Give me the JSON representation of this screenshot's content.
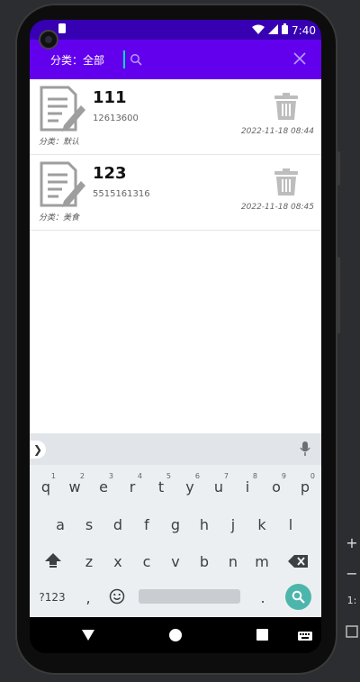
{
  "status_bar": {
    "time": "7:40"
  },
  "app_bar": {
    "category_label": "分类：全部",
    "search_value": "",
    "search_icon": "search-icon",
    "clear_icon": "close-icon"
  },
  "notes": [
    {
      "title": "111",
      "content": "12613600",
      "category": "分类：默认",
      "time": "2022-11-18 08:44"
    },
    {
      "title": "123",
      "content": "5515161316",
      "category": "分类：美食",
      "time": "2022-11-18 08:45"
    }
  ],
  "keyboard": {
    "row1": [
      {
        "key": "q",
        "sup": "1"
      },
      {
        "key": "w",
        "sup": "2"
      },
      {
        "key": "e",
        "sup": "3"
      },
      {
        "key": "r",
        "sup": "4"
      },
      {
        "key": "t",
        "sup": "5"
      },
      {
        "key": "y",
        "sup": "6"
      },
      {
        "key": "u",
        "sup": "7"
      },
      {
        "key": "i",
        "sup": "8"
      },
      {
        "key": "o",
        "sup": "9"
      },
      {
        "key": "p",
        "sup": "0"
      }
    ],
    "row2": [
      "a",
      "s",
      "d",
      "f",
      "g",
      "h",
      "j",
      "k",
      "l"
    ],
    "row3": [
      "z",
      "x",
      "c",
      "v",
      "b",
      "n",
      "m"
    ],
    "symbols_label": "?123",
    "comma": ",",
    "period": "."
  },
  "colors": {
    "app_bar": "#6200ee",
    "status_bar": "#3700b3",
    "accent": "#03dac6",
    "search_key": "#4db6ac"
  }
}
